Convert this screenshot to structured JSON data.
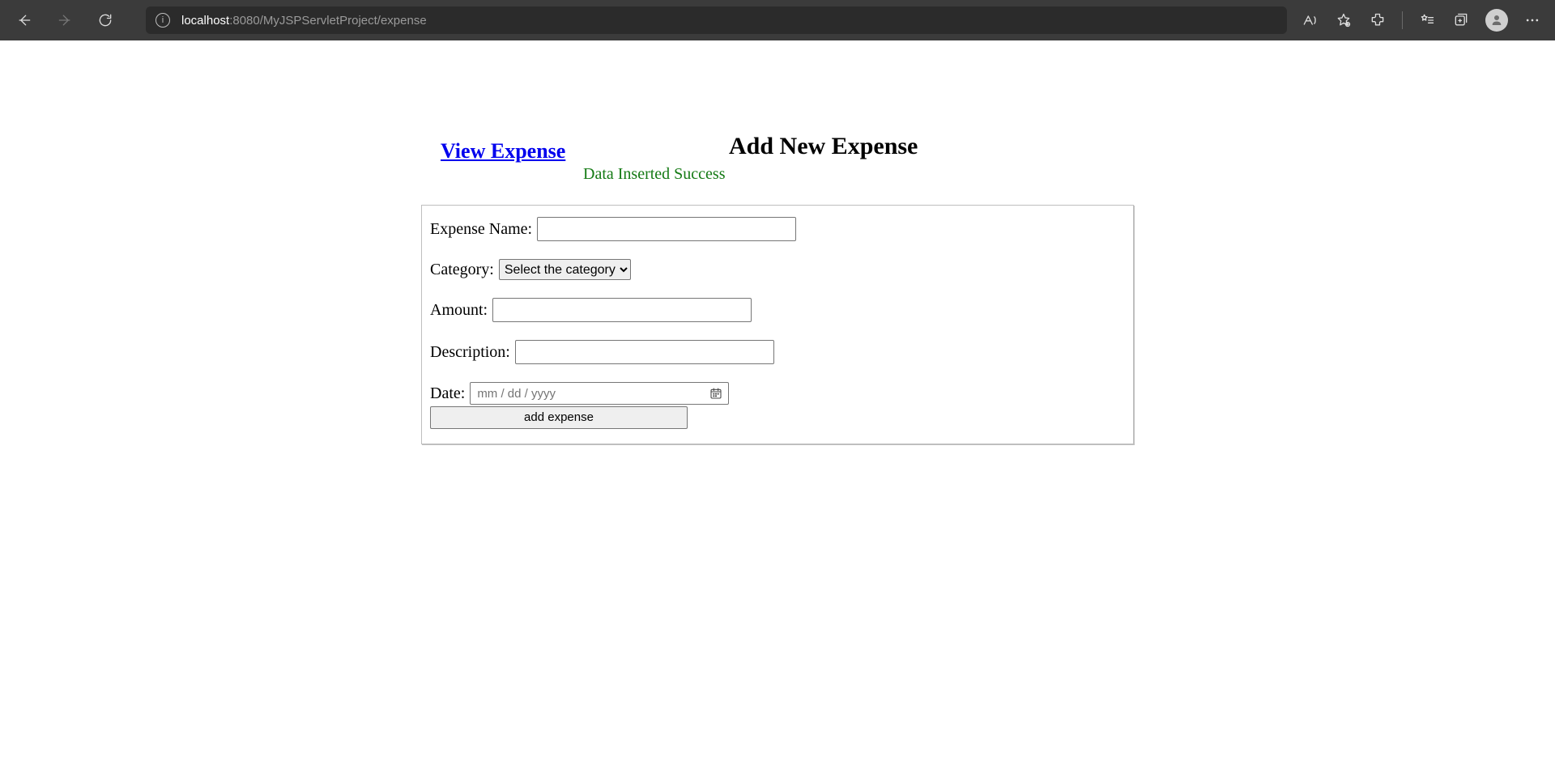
{
  "browser": {
    "url_host": "localhost",
    "url_rest": ":8080/MyJSPServletProject/expense"
  },
  "page": {
    "title": "Add New Expense",
    "view_link": "View Expense",
    "status": "Data Inserted Success"
  },
  "form": {
    "expense_name_label": "Expense Name:",
    "expense_name_value": "",
    "category_label": "Category:",
    "category_placeholder": "Select the category",
    "amount_label": "Amount:",
    "amount_value": "",
    "description_label": "Description:",
    "description_value": "",
    "date_label": "Date:",
    "date_placeholder": "mm / dd / yyyy",
    "submit_label": "add expense"
  }
}
